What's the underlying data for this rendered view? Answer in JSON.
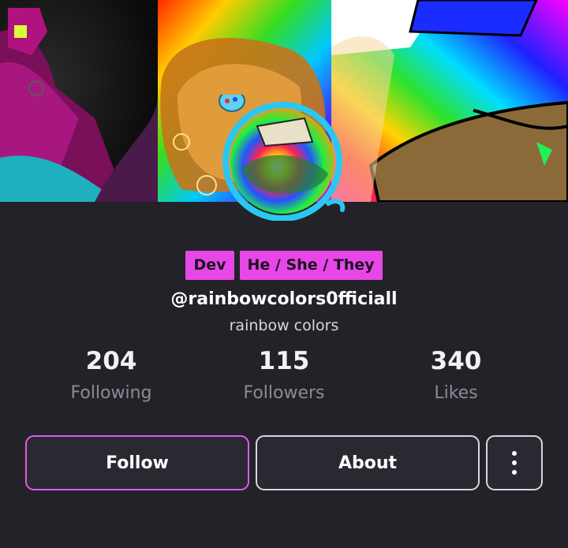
{
  "profile": {
    "badges": [
      "Dev",
      "He / She / They"
    ],
    "handle": "@rainbowcolors0fficiall",
    "display_name": "rainbow colors"
  },
  "stats": [
    {
      "value": "204",
      "label": "Following"
    },
    {
      "value": "115",
      "label": "Followers"
    },
    {
      "value": "340",
      "label": "Likes"
    }
  ],
  "actions": {
    "follow_label": "Follow",
    "about_label": "About",
    "more_icon": "more-vertical-icon"
  },
  "colors": {
    "background": "#242229",
    "badge": "#e847e8",
    "follow_border": "#e05ae8"
  }
}
